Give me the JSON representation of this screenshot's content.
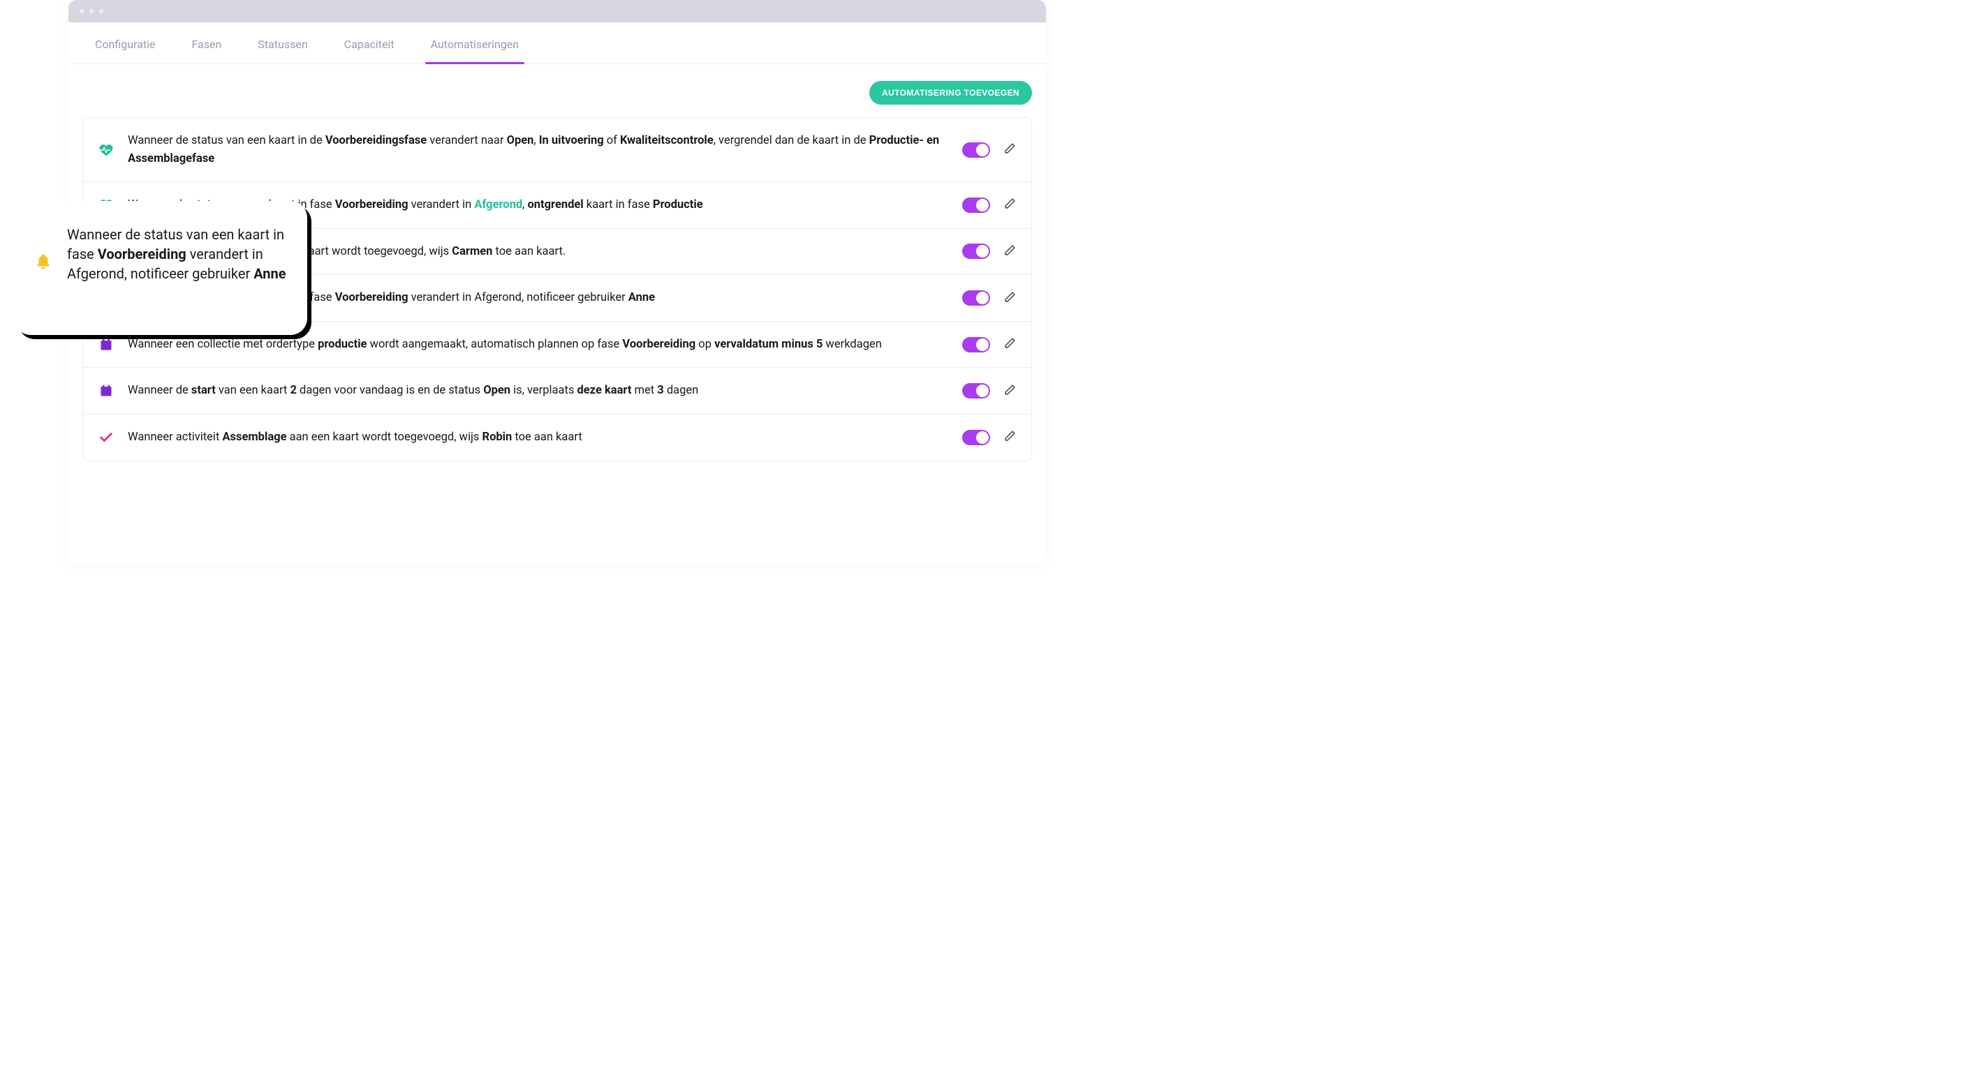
{
  "tabs": [
    "Configuratie",
    "Fasen",
    "Statussen",
    "Capaciteit",
    "Automatiseringen"
  ],
  "activeTab": 4,
  "addButton": "AUTOMATISERING TOEVOEGEN",
  "rows": [
    {
      "icon": "heartbeat",
      "iconColor": "#1FC29A",
      "html": "Wanneer de status van een kaart in de <b>Voorbereidingsfase</b> verandert naar <b>Open</b>, <b>In uitvoering</b> of <b>Kwaliteitscontrole</b>, vergrendel dan de kaart in de <b>Productie- en Assemblagefase</b>"
    },
    {
      "icon": "heartbeat",
      "iconColor": "#1FC29A",
      "html": "Wanneer de status van een kaart in fase <b>Voorbereiding</b> verandert in <span class='green'>Afgerond</span>, <b>ontgrendel</b> kaart in fase <b>Productie</b>"
    },
    {
      "icon": "check",
      "iconColor": "#E72A8B",
      "html": "Wanneer activiteit <b>Materialen</b> aan kaart wordt toegevoegd, wijs <b>Carmen</b> toe aan kaart."
    },
    {
      "icon": "bell",
      "iconColor": "#F5C324",
      "html": "Wanneer de status van een kaart in fase <b>Voorbereiding</b> verandert in Afgerond, notificeer gebruiker <b>Anne</b>"
    },
    {
      "icon": "calendar",
      "iconColor": "#8026D9",
      "html": "Wanneer een collectie met ordertype <b>productie</b> wordt aangemaakt, automatisch plannen op fase <b>Voorbereiding</b> op <b>vervaldatum minus 5</b> werkdagen"
    },
    {
      "icon": "calendar",
      "iconColor": "#8026D9",
      "html": "Wanneer de <b>start</b> van een kaart <b>2</b> dagen voor vandaag is en de status <b>Open</b> is, verplaats <b>deze kaart</b> met <b>3</b> dagen"
    },
    {
      "icon": "check",
      "iconColor": "#E72A8B",
      "html": "Wanneer activiteit <b>Assemblage</b> aan een kaart wordt toegevoegd, wijs <b>Robin</b> toe aan kaart"
    }
  ],
  "callout": {
    "html": "Wanneer de status van een kaart in fase <b>Voorbereiding</b> verandert in Afgerond, notificeer gebruiker <b>Anne</b>"
  }
}
